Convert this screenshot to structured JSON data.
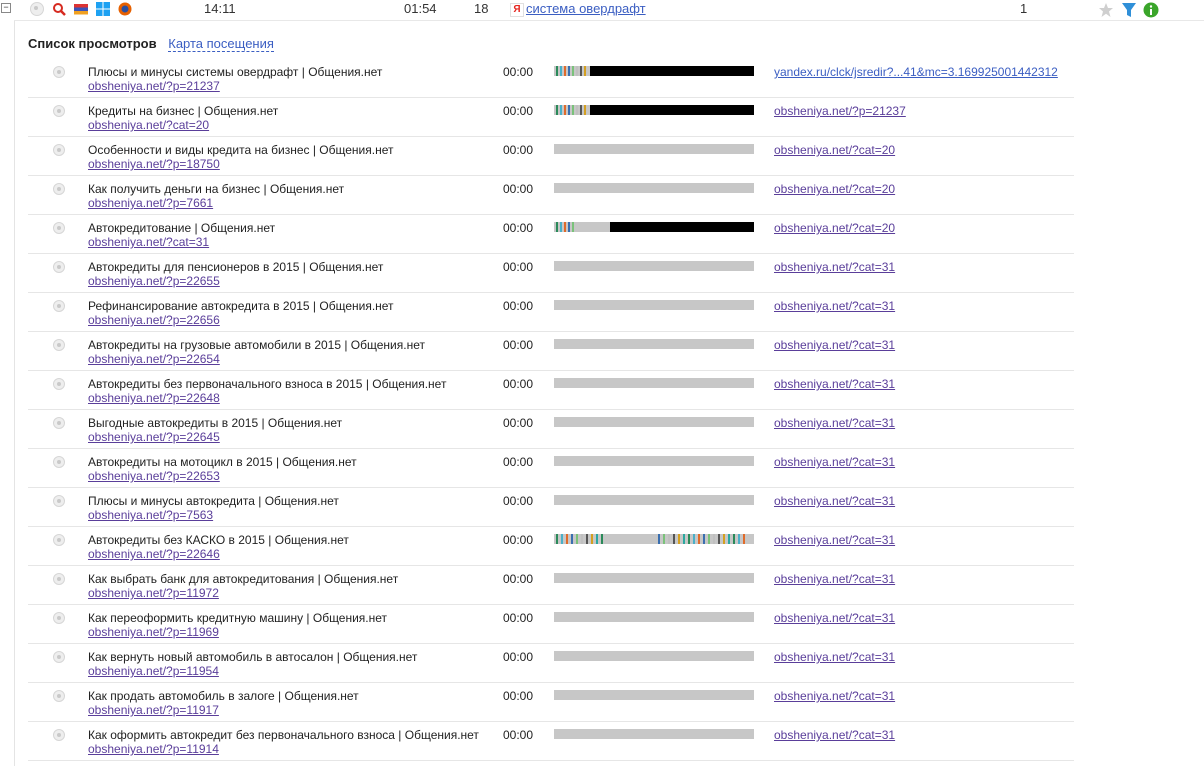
{
  "top_row": {
    "icons": [
      "dot-icon",
      "search-icon",
      "flag-icon",
      "windows-icon",
      "firefox-icon"
    ],
    "time_start": "14:11",
    "duration": "01:54",
    "views": "18",
    "search_query": "система овердрафт",
    "count": "1",
    "actions": [
      "star-icon",
      "filter-icon",
      "info-icon"
    ]
  },
  "section": {
    "title": "Список просмотров",
    "tab_map": "Карта посещения"
  },
  "colors": {
    "link": "#3b5ec2",
    "visited": "#5a3e9a",
    "bar_gray": "#c7c7c7",
    "bar_black": "#000000"
  },
  "views": [
    {
      "title": "Плюсы и минусы системы овердрафт | Общения.нет",
      "url": "obsheniya.net/?p=21237",
      "time": "00:00",
      "ref": "yandex.ru/clck/jsredir?...41&mc=3.169925001442312",
      "activity": "black-high"
    },
    {
      "title": "Кредиты на бизнес | Общения.нет",
      "url": "obsheniya.net/?cat=20",
      "time": "00:00",
      "ref": "obsheniya.net/?p=21237",
      "activity": "black-high"
    },
    {
      "title": "Особенности и виды кредита на бизнес | Общения.нет",
      "url": "obsheniya.net/?p=18750",
      "time": "00:00",
      "ref": "obsheniya.net/?cat=20",
      "activity": "none"
    },
    {
      "title": "Как получить деньги на бизнес | Общения.нет",
      "url": "obsheniya.net/?p=7661",
      "time": "00:00",
      "ref": "obsheniya.net/?cat=20",
      "activity": "none"
    },
    {
      "title": "Автокредитование | Общения.нет",
      "url": "obsheniya.net/?cat=31",
      "time": "00:00",
      "ref": "obsheniya.net/?cat=20",
      "activity": "black-mid"
    },
    {
      "title": "Автокредиты для пенсионеров в 2015 | Общения.нет",
      "url": "obsheniya.net/?p=22655",
      "time": "00:00",
      "ref": "obsheniya.net/?cat=31",
      "activity": "none"
    },
    {
      "title": "Рефинансирование автокредита в 2015 | Общения.нет",
      "url": "obsheniya.net/?p=22656",
      "time": "00:00",
      "ref": "obsheniya.net/?cat=31",
      "activity": "none"
    },
    {
      "title": "Автокредиты на грузовые автомобили в 2015 | Общения.нет",
      "url": "obsheniya.net/?p=22654",
      "time": "00:00",
      "ref": "obsheniya.net/?cat=31",
      "activity": "none"
    },
    {
      "title": "Автокредиты без первоначального взноса в 2015 | Общения.нет",
      "url": "obsheniya.net/?p=22648",
      "time": "00:00",
      "ref": "obsheniya.net/?cat=31",
      "activity": "none"
    },
    {
      "title": "Выгодные автокредиты в 2015 | Общения.нет",
      "url": "obsheniya.net/?p=22645",
      "time": "00:00",
      "ref": "obsheniya.net/?cat=31",
      "activity": "none"
    },
    {
      "title": "Автокредиты на мотоцикл в 2015 | Общения.нет",
      "url": "obsheniya.net/?p=22653",
      "time": "00:00",
      "ref": "obsheniya.net/?cat=31",
      "activity": "none"
    },
    {
      "title": "Плюсы и минусы автокредита | Общения.нет",
      "url": "obsheniya.net/?p=7563",
      "time": "00:00",
      "ref": "obsheniya.net/?cat=31",
      "activity": "none"
    },
    {
      "title": "Автокредиты без КАСКО в 2015 | Общения.нет",
      "url": "obsheniya.net/?p=22646",
      "time": "00:00",
      "ref": "obsheniya.net/?cat=31",
      "activity": "stripes"
    },
    {
      "title": "Как выбрать банк для автокредитования | Общения.нет",
      "url": "obsheniya.net/?p=11972",
      "time": "00:00",
      "ref": "obsheniya.net/?cat=31",
      "activity": "none"
    },
    {
      "title": "Как переоформить кредитную машину | Общения.нет",
      "url": "obsheniya.net/?p=11969",
      "time": "00:00",
      "ref": "obsheniya.net/?cat=31",
      "activity": "none"
    },
    {
      "title": "Как вернуть новый автомобиль в автосалон | Общения.нет",
      "url": "obsheniya.net/?p=11954",
      "time": "00:00",
      "ref": "obsheniya.net/?cat=31",
      "activity": "none"
    },
    {
      "title": "Как продать автомобиль в залоге | Общения.нет",
      "url": "obsheniya.net/?p=11917",
      "time": "00:00",
      "ref": "obsheniya.net/?cat=31",
      "activity": "none"
    },
    {
      "title": "Как оформить автокредит без первоначального взноса | Общения.нет",
      "url": "obsheniya.net/?p=11914",
      "time": "00:00",
      "ref": "obsheniya.net/?cat=31",
      "activity": "none"
    }
  ]
}
